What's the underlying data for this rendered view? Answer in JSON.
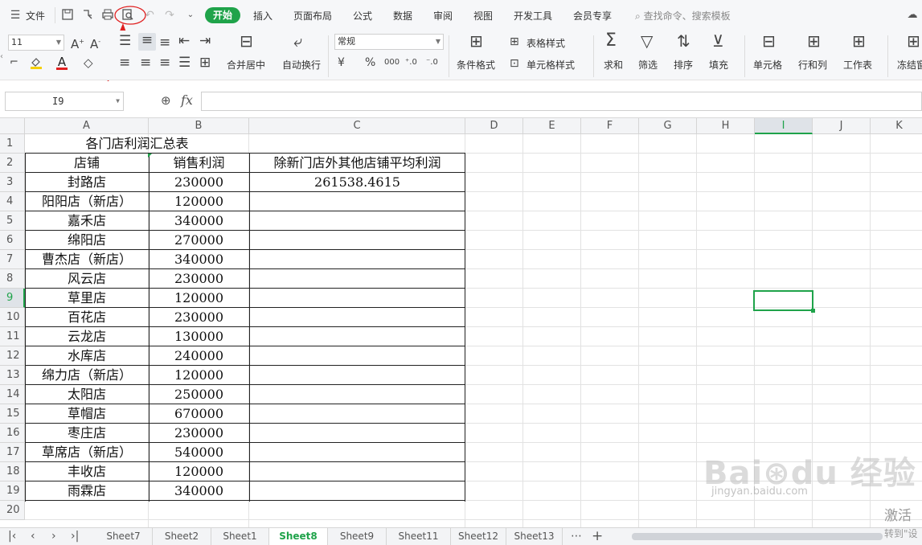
{
  "menubar": {
    "file_label": "文件",
    "tabs": [
      "开始",
      "插入",
      "页面布局",
      "公式",
      "数据",
      "审阅",
      "视图",
      "开发工具",
      "会员专享"
    ],
    "search_placeholder": "查找命令、搜索模板"
  },
  "ribbon": {
    "font_size": "11",
    "number_format": "常规",
    "merge_center": "合并居中",
    "wrap_text": "自动换行",
    "conditional_format": "条件格式",
    "table_style": "表格样式",
    "cell_style": "单元格样式",
    "sum": "求和",
    "filter": "筛选",
    "sort": "排序",
    "fill": "填充",
    "cells": "单元格",
    "row_col": "行和列",
    "worksheet": "工作表",
    "freeze": "冻结窗",
    "currency_symbol": "¥",
    "percent_symbol": "%"
  },
  "formula_bar": {
    "name_box": "I9",
    "fx_label": "fx",
    "formula": ""
  },
  "grid": {
    "columns": [
      "A",
      "B",
      "C",
      "D",
      "E",
      "F",
      "G",
      "H",
      "I",
      "J",
      "K"
    ],
    "rows": [
      "1",
      "2",
      "3",
      "4",
      "5",
      "6",
      "7",
      "8",
      "9",
      "10",
      "11",
      "12",
      "13",
      "14",
      "15",
      "16",
      "17",
      "18",
      "19",
      "20"
    ],
    "title": "各门店利润汇总表",
    "header_store": "店铺",
    "header_profit": "销售利润",
    "header_avg": "除新门店外其他店铺平均利润",
    "avg_value": "261538.4615",
    "stores": [
      "封路店",
      "阳阳店（新店）",
      "嘉禾店",
      "绵阳店",
      "曹杰店（新店）",
      "风云店",
      "草里店",
      "百花店",
      "云龙店",
      "水库店",
      "绵力店（新店）",
      "太阳店",
      "草帽店",
      "枣庄店",
      "草席店（新店）",
      "丰收店",
      "雨霖店"
    ],
    "profits": [
      "230000",
      "120000",
      "340000",
      "270000",
      "340000",
      "230000",
      "120000",
      "230000",
      "130000",
      "240000",
      "120000",
      "250000",
      "670000",
      "230000",
      "540000",
      "120000",
      "340000"
    ]
  },
  "sheet_tabs": [
    "Sheet7",
    "Sheet2",
    "Sheet1",
    "Sheet8",
    "Sheet9",
    "Sheet11",
    "Sheet12",
    "Sheet13"
  ],
  "active_sheet": "Sheet8",
  "watermark": {
    "activate_line1": "激活",
    "activate_line2": "转到\"设"
  },
  "colors": {
    "accent": "#1fa34a",
    "annotation": "#e02020"
  }
}
